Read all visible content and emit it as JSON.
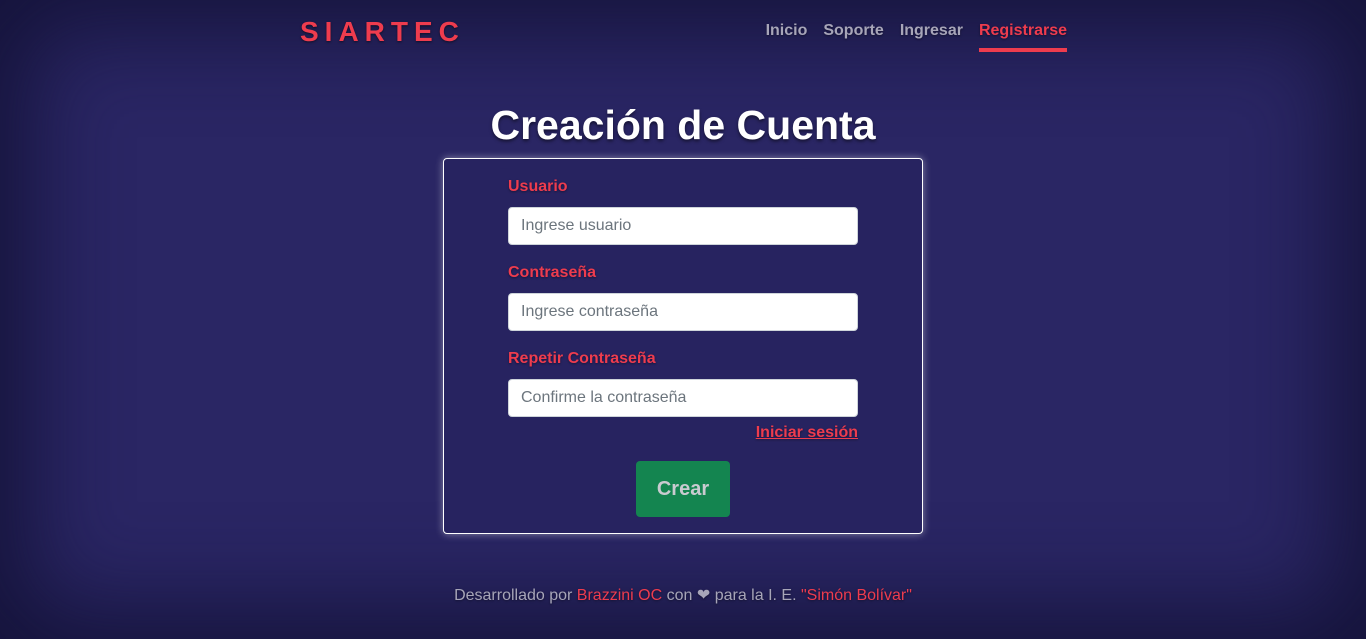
{
  "header": {
    "brand": "SIARTEC",
    "nav": [
      {
        "label": "Inicio",
        "active": false
      },
      {
        "label": "Soporte",
        "active": false
      },
      {
        "label": "Ingresar",
        "active": false
      },
      {
        "label": "Registrarse",
        "active": true
      }
    ]
  },
  "main": {
    "title": "Creación de Cuenta",
    "form": {
      "username": {
        "label": "Usuario",
        "placeholder": "Ingrese usuario",
        "value": ""
      },
      "password": {
        "label": "Contraseña",
        "placeholder": "Ingrese contraseña",
        "value": ""
      },
      "confirm": {
        "label": "Repetir Contraseña",
        "placeholder": "Confirme la contraseña",
        "value": ""
      },
      "login_link": "Iniciar sesión",
      "submit_label": "Crear"
    }
  },
  "footer": {
    "prefix": "Desarrollado por",
    "author": "Brazzini OC",
    "middle": "con ❤ para la I. E.",
    "school": "\"Simón Bolívar\""
  },
  "colors": {
    "background": "#2a2664",
    "accent": "#ee3c4e",
    "nav_text": "#a7a5b8",
    "button": "#148550"
  }
}
